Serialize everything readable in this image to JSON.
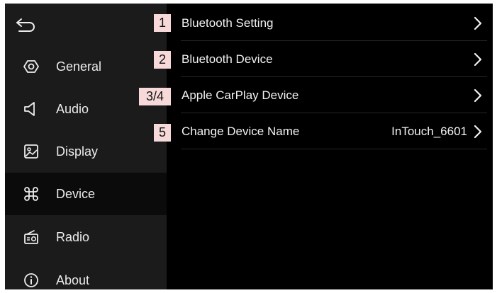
{
  "sidebar": {
    "back_icon": "back-arrow-icon",
    "items": [
      {
        "label": "General",
        "icon": "hexagon-settings-icon",
        "active": false
      },
      {
        "label": "Audio",
        "icon": "speaker-icon",
        "active": false
      },
      {
        "label": "Display",
        "icon": "image-icon",
        "active": false
      },
      {
        "label": "Device",
        "icon": "command-key-icon",
        "active": true
      },
      {
        "label": "Radio",
        "icon": "radio-icon",
        "active": false
      },
      {
        "label": "About",
        "icon": "info-icon",
        "active": false
      }
    ]
  },
  "main": {
    "rows": [
      {
        "label": "Bluetooth Setting",
        "value": "",
        "badge": "1"
      },
      {
        "label": "Bluetooth Device",
        "value": "",
        "badge": "2"
      },
      {
        "label": "Apple CarPlay Device",
        "value": "",
        "badge": "3/4"
      },
      {
        "label": "Change Device Name",
        "value": "InTouch_6601",
        "badge": "5"
      }
    ]
  },
  "colors": {
    "screen_bg": "#000000",
    "sidebar_bg": "#1b1b1b",
    "active_item_bg": "#0b0b0b",
    "text": "#f2f2f2",
    "badge_bg": "#f7d9d9"
  }
}
